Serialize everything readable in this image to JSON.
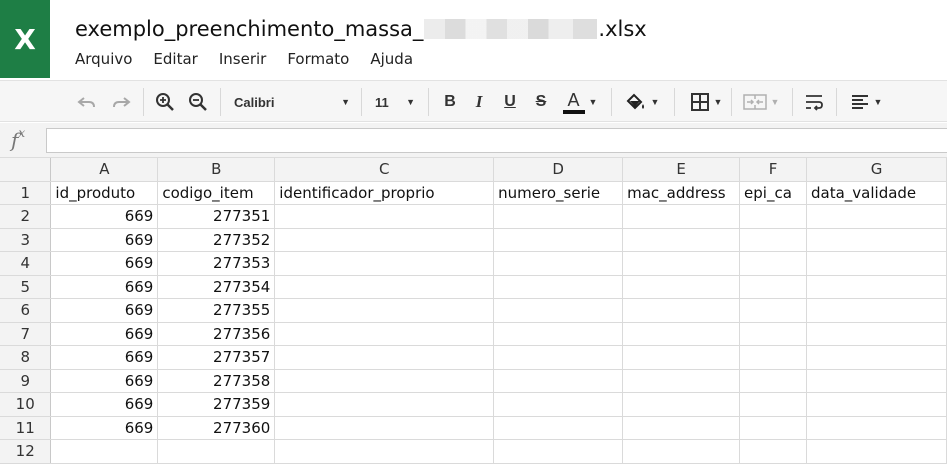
{
  "app": {
    "logo_letter": "X",
    "brand_color": "#1e7e45",
    "title_prefix": "exemplo_preenchimento_massa_",
    "title_suffix": ".xlsx"
  },
  "menu": [
    "Arquivo",
    "Editar",
    "Inserir",
    "Formato",
    "Ajuda"
  ],
  "toolbar": {
    "font_name": "Calibri",
    "font_size": "11",
    "bold_label": "B",
    "italic_label": "I",
    "underline_label": "U",
    "strike_label": "S",
    "text_color_label": "A",
    "icons": [
      "undo-icon",
      "redo-icon",
      "zoom-in-icon",
      "zoom-out-icon",
      "fill-color-icon",
      "borders-icon",
      "merge-cells-icon",
      "wrap-text-icon",
      "align-left-icon"
    ]
  },
  "formula_bar": {
    "fx_label": "f",
    "fx_sup": "x",
    "value": ""
  },
  "sheet": {
    "columns": [
      "A",
      "B",
      "C",
      "D",
      "E",
      "F",
      "G"
    ],
    "row_numbers": [
      "1",
      "2",
      "3",
      "4",
      "5",
      "6",
      "7",
      "8",
      "9",
      "10",
      "11",
      "12"
    ],
    "header_row": [
      "id_produto",
      "codigo_item",
      "identificador_proprio",
      "numero_serie",
      "mac_address",
      "epi_ca",
      "data_validade"
    ],
    "rows": [
      [
        "669",
        "277351",
        "",
        "",
        "",
        "",
        ""
      ],
      [
        "669",
        "277352",
        "",
        "",
        "",
        "",
        ""
      ],
      [
        "669",
        "277353",
        "",
        "",
        "",
        "",
        ""
      ],
      [
        "669",
        "277354",
        "",
        "",
        "",
        "",
        ""
      ],
      [
        "669",
        "277355",
        "",
        "",
        "",
        "",
        ""
      ],
      [
        "669",
        "277356",
        "",
        "",
        "",
        "",
        ""
      ],
      [
        "669",
        "277357",
        "",
        "",
        "",
        "",
        ""
      ],
      [
        "669",
        "277358",
        "",
        "",
        "",
        "",
        ""
      ],
      [
        "669",
        "277359",
        "",
        "",
        "",
        "",
        ""
      ],
      [
        "669",
        "277360",
        "",
        "",
        "",
        "",
        ""
      ],
      [
        "",
        "",
        "",
        "",
        "",
        "",
        ""
      ]
    ]
  }
}
